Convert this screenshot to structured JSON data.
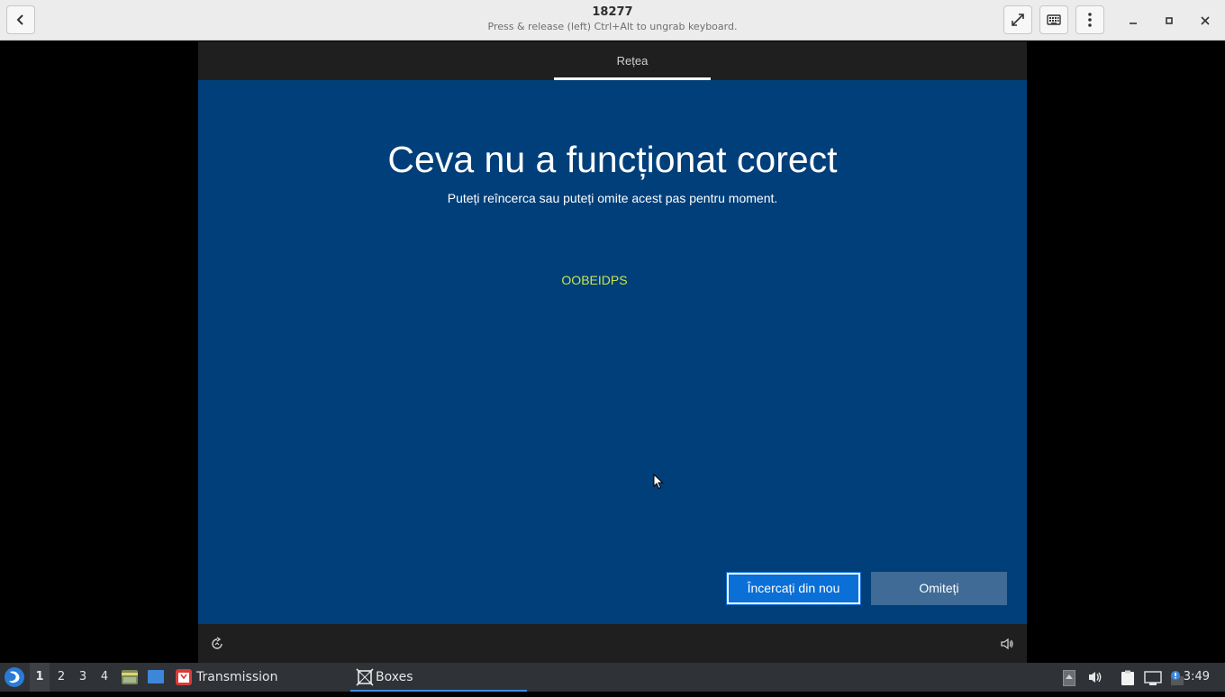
{
  "header": {
    "title": "18277",
    "subtitle": "Press & release (left) Ctrl+Alt to ungrab keyboard.",
    "back_icon": "back-arrow-icon",
    "fullscreen_icon": "fullscreen-icon",
    "keyboard_icon": "keyboard-icon",
    "menu_icon": "kebab-menu-icon"
  },
  "vm": {
    "tab_label": "Rețea",
    "title": "Ceva nu a funcționat corect",
    "subtitle": "Puteți reîncerca sau puteți omite acest pas pentru moment.",
    "error_code": "OOBEIDPS",
    "retry_button": "Încercați din nou",
    "skip_button": "Omiteți",
    "colors": {
      "background": "#003f7a",
      "bar": "#1f1f1f",
      "primary_button": "#0a6fd6",
      "secondary_button": "#3f6b96",
      "error_code": "#c8e64b"
    }
  },
  "taskbar": {
    "workspaces": [
      "1",
      "2",
      "3",
      "4"
    ],
    "active_workspace": "1",
    "tasks": [
      {
        "label": "Transmission",
        "icon": "transmission-icon"
      },
      {
        "label": "Boxes",
        "icon": "boxes-icon"
      }
    ],
    "clock": "3:49"
  }
}
